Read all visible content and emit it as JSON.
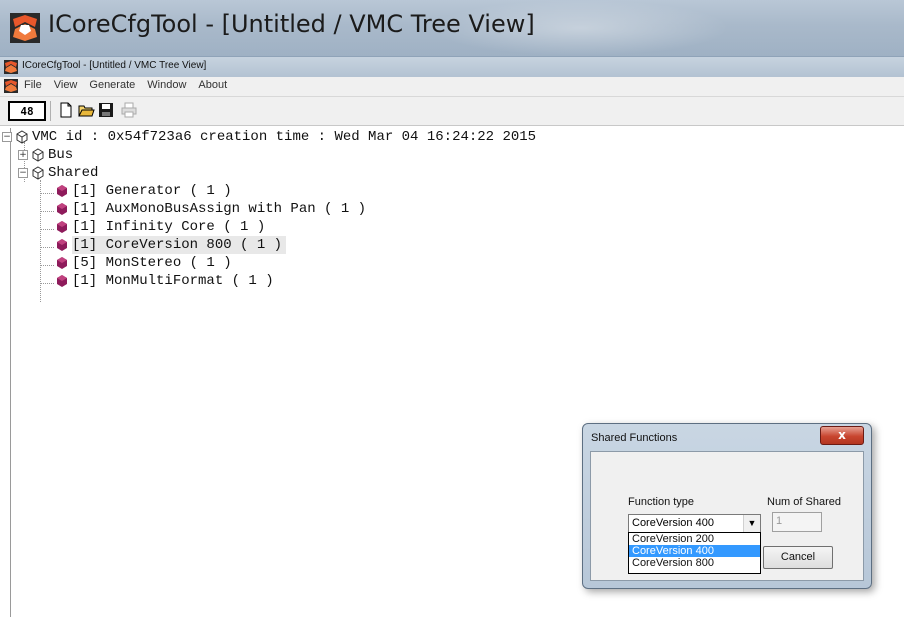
{
  "outer_window": {
    "title": "ICoreCfgTool - [Untitled / VMC Tree View]"
  },
  "inner_window": {
    "title": "ICoreCfgTool - [Untitled / VMC Tree View]"
  },
  "menu": [
    {
      "label": "File"
    },
    {
      "label": "View"
    },
    {
      "label": "Generate"
    },
    {
      "label": "Window"
    },
    {
      "label": "About"
    }
  ],
  "toolbar": {
    "badge": "48",
    "icons": [
      "new-file-icon",
      "open-folder-icon",
      "save-icon",
      "print-icon"
    ]
  },
  "tree": {
    "root": "VMC id : 0x54f723a6 creation time : Wed Mar 04 16:24:22 2015",
    "bus": "Bus",
    "shared": "Shared",
    "children": [
      "[1] Generator ( 1 )",
      "[1] AuxMonoBusAssign with Pan ( 1 )",
      "[1] Infinity Core ( 1 )",
      "[1] CoreVersion 800 ( 1 )",
      "[5] MonStereo ( 1 )",
      "[1] MonMultiFormat ( 1 )"
    ]
  },
  "dialog": {
    "title": "Shared Functions",
    "close_label": "x",
    "function_type_label": "Function type",
    "num_shared_label": "Num of Shared",
    "selected_value": "CoreVersion 400",
    "options": [
      "CoreVersion 200",
      "CoreVersion 400",
      "CoreVersion 800"
    ],
    "num_shared_value": "1",
    "cancel_label": "Cancel"
  },
  "colors": {
    "selection_blue": "#3399ff",
    "close_red": "#c8452f"
  }
}
